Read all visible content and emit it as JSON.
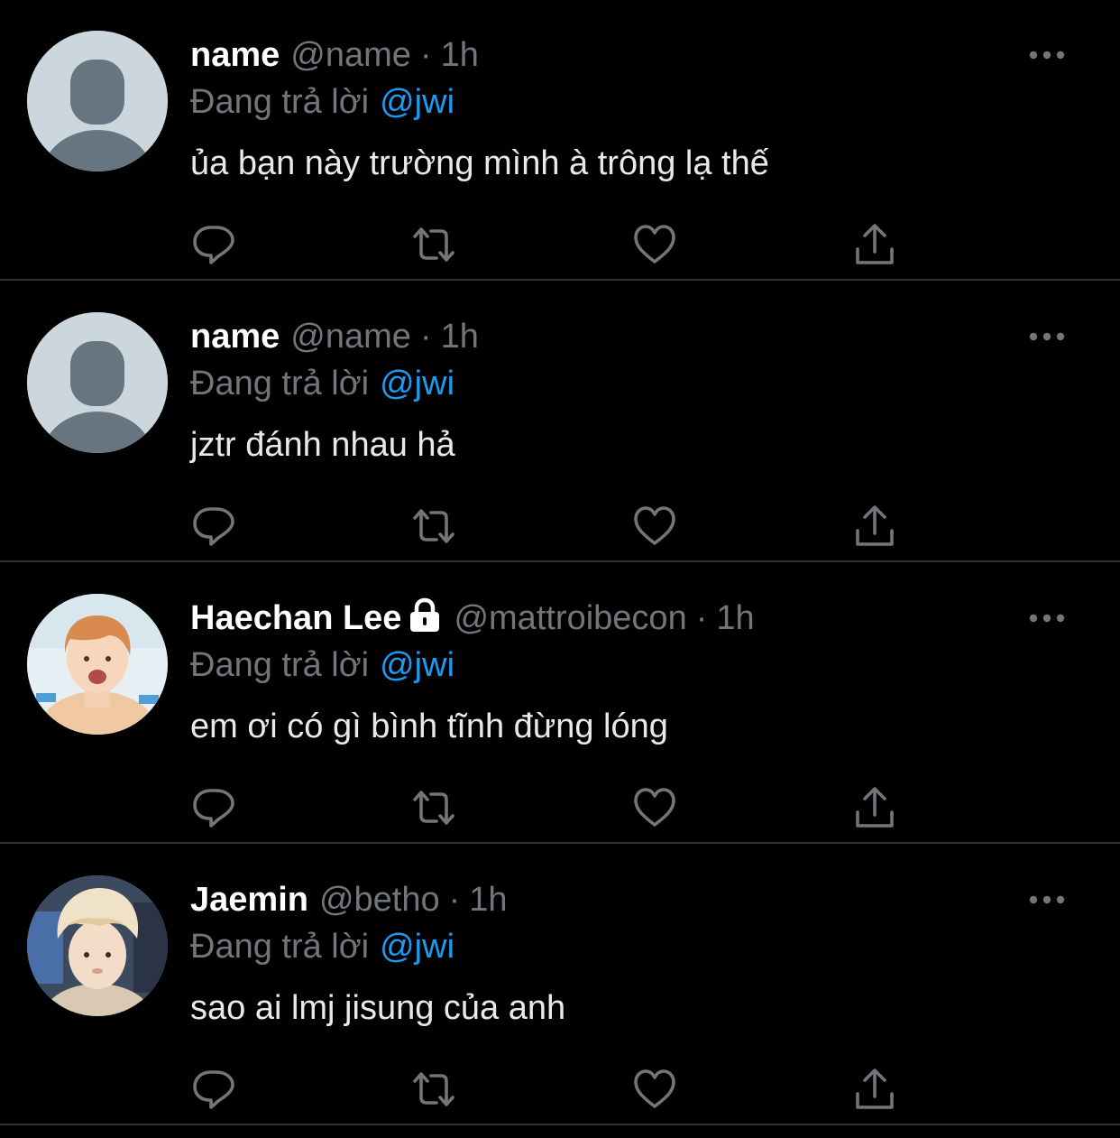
{
  "colors": {
    "background": "#000000",
    "primary_text": "#ffffff",
    "secondary_text": "#71767b",
    "link": "#1d9bf0",
    "divider": "#2f3336"
  },
  "tweets": [
    {
      "display_name": "name",
      "handle": "@name",
      "separator": "·",
      "time": "1h",
      "protected": false,
      "reply_prefix": "Đang trả lời",
      "reply_to": "@jwi",
      "text": "ủa bạn này trường mình à trông lạ thế",
      "avatar": "default-avatar"
    },
    {
      "display_name": "name",
      "handle": "@name",
      "separator": "·",
      "time": "1h",
      "protected": false,
      "reply_prefix": "Đang trả lời",
      "reply_to": "@jwi",
      "text": "jztr đánh nhau hả",
      "avatar": "default-avatar"
    },
    {
      "display_name": "Haechan Lee",
      "handle": "@mattroibecon",
      "separator": "·",
      "time": "1h",
      "protected": true,
      "reply_prefix": "Đang trả lời",
      "reply_to": "@jwi",
      "text": "em ơi có gì bình tĩnh đừng lóng",
      "avatar": "photo-avatar"
    },
    {
      "display_name": "Jaemin",
      "handle": "@betho",
      "separator": "·",
      "time": "1h",
      "protected": false,
      "reply_prefix": "Đang trả lời",
      "reply_to": "@jwi",
      "text": "sao ai lmj jisung của anh",
      "avatar": "photo-avatar"
    }
  ],
  "icons": {
    "more": "more-horizontal-icon",
    "reply": "reply-bubble-icon",
    "retweet": "retweet-icon",
    "like": "heart-icon",
    "share": "share-upload-icon",
    "lock": "lock-icon"
  }
}
